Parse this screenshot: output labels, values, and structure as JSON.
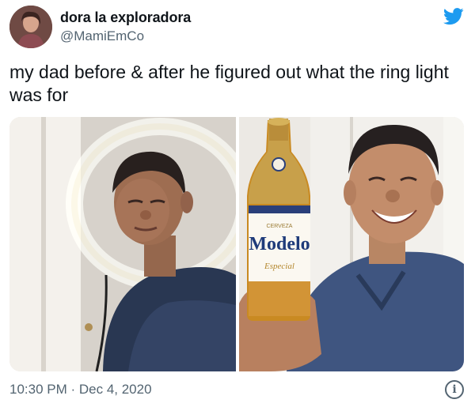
{
  "author": {
    "display_name": "dora la exploradora",
    "handle": "@MamiEmCo",
    "avatar_icon": "profile-avatar",
    "platform_icon": "twitter-bird-icon"
  },
  "tweet": {
    "text": "my dad before & after he figured out what the ring light was for"
  },
  "media": {
    "beer_label": {
      "brand": "Modelo",
      "top": "CERVEZA",
      "sub": "Especial"
    }
  },
  "footer": {
    "timestamp": "10:30 PM · Dec 4, 2020",
    "info_icon": "info-icon",
    "info_glyph": "i"
  },
  "colors": {
    "twitter_blue": "#1d9bf0",
    "text_primary": "#0f1419",
    "text_secondary": "#536471"
  }
}
